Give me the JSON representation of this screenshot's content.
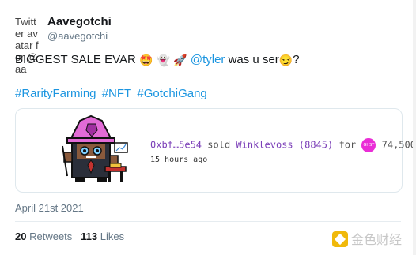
{
  "author": {
    "avatar_alt": "Twitter avatar for @aa",
    "name": "Aavegotchi",
    "handle": "@aavegotchi"
  },
  "tweet": {
    "text_start": "BIGGEST SALE EVAR",
    "emojis": [
      "star-struck",
      "ghost",
      "rocket"
    ],
    "mention": "@tyler",
    "text_after_mention": "was u ser",
    "trailing_emoji": "smirking-face",
    "text_end": "?",
    "hashtags": [
      "#RarityFarming",
      "#NFT",
      "#GotchiGang"
    ]
  },
  "card": {
    "buyer": "0xbf…5e54",
    "verb": "sold",
    "item": "Winklevoss (8845)",
    "for_label": "for",
    "token_badge": "GHST",
    "price": "74,500",
    "time_ago": "15 hours ago"
  },
  "date": "April 21st 2021",
  "stats": {
    "retweets_count": "20",
    "retweets_label": "Retweets",
    "likes_count": "113",
    "likes_label": "Likes"
  },
  "watermark": "金色财经",
  "colors": {
    "link": "#1b95e0",
    "purple": "#7b3fb8",
    "ghst": "#ea2dd6",
    "watermark_logo": "#f0b90b"
  }
}
